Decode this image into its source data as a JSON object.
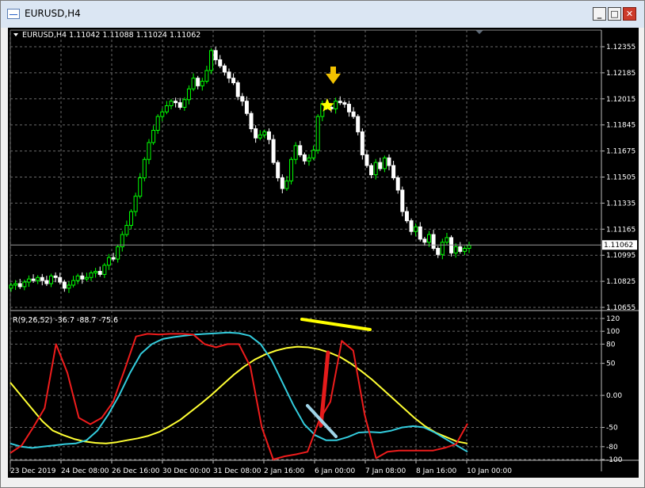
{
  "window": {
    "title": "EURUSD,H4",
    "minimize_label": "_",
    "maximize_label": "□",
    "close_label": "✕"
  },
  "colors": {
    "background": "#000000",
    "grid": "#6a6a6a",
    "bull": "#00ff00",
    "bear": "#ffffff",
    "yellow_line": "#ffff33",
    "cyan_line": "#33ccdd",
    "red_line": "#ee1c1c",
    "current_price_line": "#c0c0c0"
  },
  "chart_data": [
    {
      "type": "candlestick",
      "header": "EURUSD,H4  1.11042 1.11088 1.11024 1.11062",
      "symbol": "EURUSD",
      "timeframe": "H4",
      "ohlc_header": {
        "open": 1.11042,
        "high": 1.11088,
        "low": 1.11024,
        "close": 1.11062
      },
      "current_price": "1.11062",
      "y_ticks": [
        "1.12355",
        "1.12185",
        "1.12015",
        "1.11845",
        "1.11675",
        "1.11505",
        "1.11335",
        "1.11165",
        "1.10995",
        "1.10825",
        "1.10655"
      ],
      "ylim": [
        1.10655,
        1.12355
      ],
      "x_ticks": [
        "23 Dec 2019",
        "24 Dec 08:00",
        "26 Dec 16:00",
        "30 Dec 00:00",
        "31 Dec 08:00",
        "2 Jan 16:00",
        "6 Jan 00:00",
        "7 Jan 08:00",
        "8 Jan 16:00",
        "10 Jan 00:00"
      ],
      "grid": true,
      "annotations": [
        "down-arrow",
        "star"
      ],
      "closes": [
        1.108,
        1.1081,
        1.1079,
        1.1082,
        1.1084,
        1.1083,
        1.1085,
        1.1083,
        1.1081,
        1.1086,
        1.1085,
        1.1082,
        1.1078,
        1.108,
        1.1083,
        1.1086,
        1.1084,
        1.1085,
        1.1088,
        1.1089,
        1.1087,
        1.1093,
        1.1098,
        1.1097,
        1.1105,
        1.1113,
        1.1119,
        1.1128,
        1.1138,
        1.115,
        1.1162,
        1.1173,
        1.1181,
        1.119,
        1.1193,
        1.1197,
        1.12,
        1.1199,
        1.1196,
        1.1201,
        1.1208,
        1.1215,
        1.121,
        1.1213,
        1.122,
        1.1233,
        1.1227,
        1.1223,
        1.1219,
        1.1215,
        1.1212,
        1.1203,
        1.12,
        1.1192,
        1.1182,
        1.1176,
        1.1178,
        1.118,
        1.1175,
        1.116,
        1.115,
        1.1143,
        1.1148,
        1.1162,
        1.1171,
        1.1165,
        1.1161,
        1.1163,
        1.1168,
        1.119,
        1.1198,
        1.1196,
        1.1195,
        1.12,
        1.1199,
        1.1198,
        1.1193,
        1.119,
        1.118,
        1.1165,
        1.1158,
        1.1152,
        1.116,
        1.1156,
        1.1163,
        1.1158,
        1.115,
        1.1142,
        1.1128,
        1.1122,
        1.1115,
        1.1118,
        1.111,
        1.1108,
        1.1113,
        1.1104,
        1.11,
        1.1108,
        1.1111,
        1.1101,
        1.1105,
        1.1102,
        1.1104,
        1.1106
      ]
    },
    {
      "type": "line",
      "header": "R(9,26,52) -36.7 -88.7 -75.6",
      "y_ticks": [
        "120",
        "100",
        "80",
        "50",
        "0.00",
        "-50",
        "-80",
        "-100"
      ],
      "ylim": [
        -100,
        120
      ],
      "grid": true,
      "series": [
        {
          "values": [
            20,
            0,
            -20,
            -40,
            -55,
            -62,
            -68,
            -72,
            -74,
            -75,
            -73,
            -70,
            -67,
            -63,
            -57,
            -48,
            -38,
            -25,
            -12,
            2,
            17,
            32,
            45,
            56,
            64,
            70,
            74,
            76,
            75,
            72,
            67,
            60,
            50,
            38,
            25,
            10,
            -5,
            -20,
            -35,
            -48,
            -58,
            -65,
            -72,
            -75
          ]
        },
        {
          "values": [
            -75,
            -80,
            -82,
            -80,
            -78,
            -76,
            -75,
            -70,
            -55,
            -30,
            0,
            35,
            65,
            80,
            88,
            91,
            93,
            95,
            96,
            97,
            98,
            97,
            93,
            80,
            55,
            20,
            -15,
            -45,
            -62,
            -70,
            -70,
            -65,
            -58,
            -57,
            -58,
            -55,
            -50,
            -48,
            -50,
            -58,
            -68,
            -78,
            -88
          ]
        },
        {
          "values": [
            -90,
            -78,
            -50,
            -20,
            80,
            35,
            -35,
            -45,
            -35,
            -10,
            40,
            92,
            96,
            95,
            96,
            96,
            95,
            80,
            75,
            80,
            80,
            45,
            -50,
            -100,
            -95,
            -92,
            -88,
            -40,
            -10,
            85,
            70,
            -30,
            -98,
            -88,
            -86,
            -86,
            -86,
            -86,
            -82,
            -76,
            -44
          ]
        }
      ]
    }
  ]
}
